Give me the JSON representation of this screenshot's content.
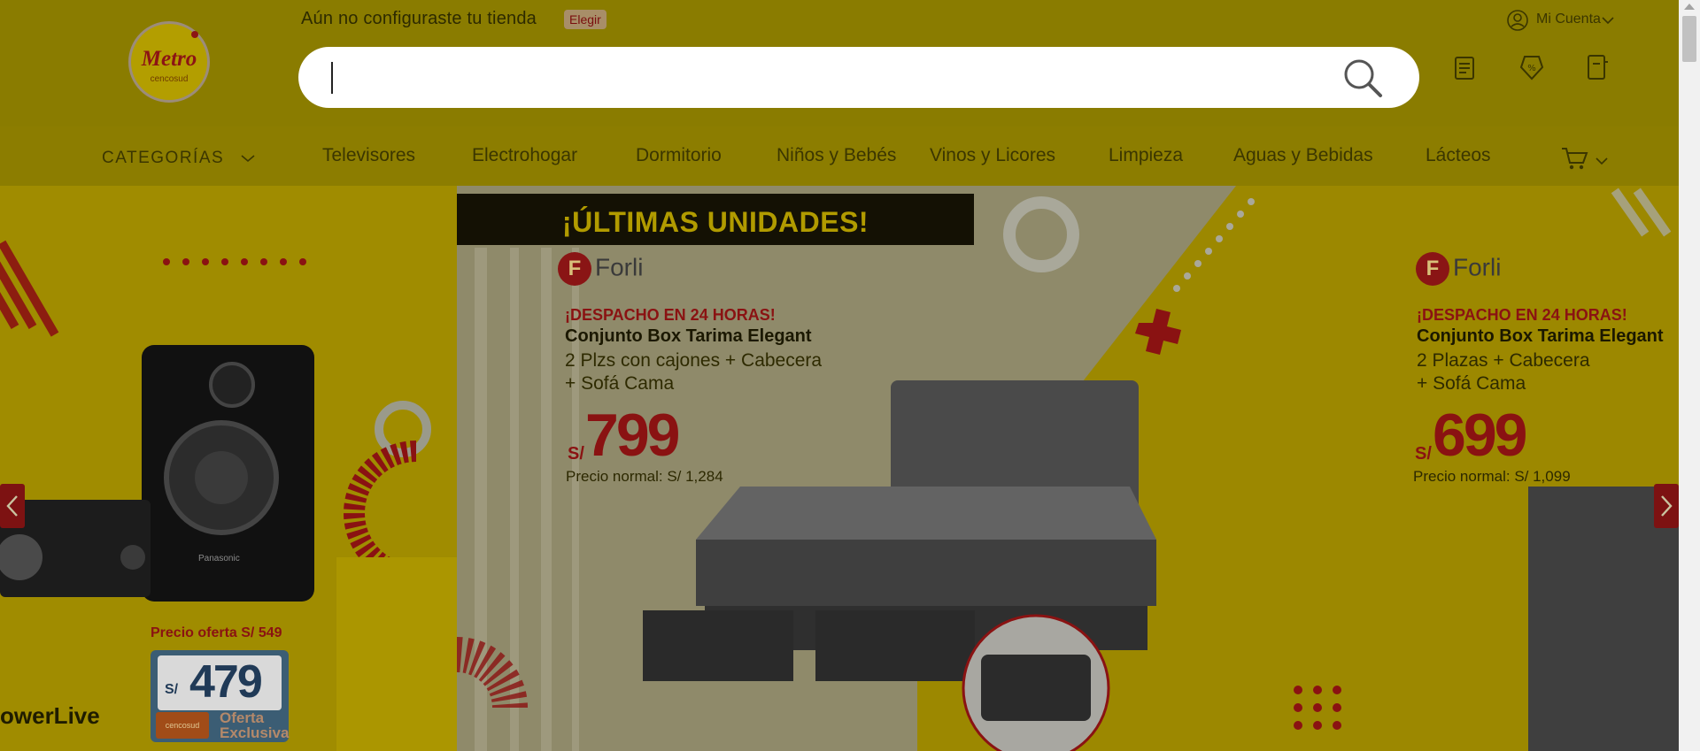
{
  "header": {
    "logo_text": "Metro",
    "logo_sub": "cencosud",
    "store_message": "Aún no configuraste tu tienda",
    "store_choose": "Elegir",
    "search": {
      "value": "",
      "placeholder": ""
    },
    "account_label": "Mi Cuenta",
    "icons": [
      "orders-icon",
      "coupons-icon",
      "lists-icon"
    ]
  },
  "nav": {
    "categories_label": "CATEGORÍAS",
    "items": [
      "Televisores",
      "Electrohogar",
      "Dormitorio",
      "Niños y Bebés",
      "Vinos y Licores",
      "Limpieza",
      "Aguas y Bebidas",
      "Lácteos"
    ]
  },
  "carousel": {
    "left_slide": {
      "offer_price_label": "Precio oferta S/ 549",
      "card_currency": "S/",
      "card_price": "479",
      "card_brand": "cencosud",
      "card_label_1": "Oferta",
      "card_label_2": "Exclusiva",
      "product_partial": "owerLive",
      "speaker_brand": "Panasonic"
    },
    "main_slide": {
      "headline": "¡ÚLTIMAS UNIDADES!",
      "brand": "Forli",
      "shipping": "¡DESPACHO EN 24 HORAS!",
      "product_name": "Conjunto Box Tarima Elegant",
      "desc_line1": "2 Plzs con cajones + Cabecera",
      "desc_line2": "+ Sofá Cama",
      "currency": "S/",
      "price": "799",
      "normal_price": "Precio normal: S/ 1,284"
    },
    "right_slide": {
      "brand": "Forli",
      "shipping": "¡DESPACHO EN 24 HORAS!",
      "product_name": "Conjunto Box Tarima Elegant",
      "desc_line1": "2 Plazas + Cabecera",
      "desc_line2": "+ Sofá Cama",
      "currency": "S/",
      "price": "699",
      "normal_price": "Precio normal: S/ 1,099"
    }
  },
  "colors": {
    "overlay_yellow": "#8a7c00",
    "accent_red": "#8a1212",
    "dark": "#141104"
  }
}
